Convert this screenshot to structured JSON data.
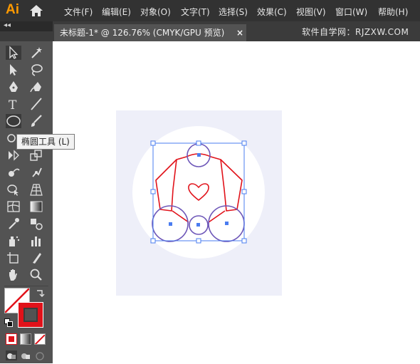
{
  "app": {
    "logo": "Ai"
  },
  "menu": {
    "items": [
      "文件(F)",
      "编辑(E)",
      "对象(O)",
      "文字(T)",
      "选择(S)",
      "效果(C)",
      "视图(V)",
      "窗口(W)",
      "帮助(H)"
    ]
  },
  "tab": {
    "title": "未标题-1* @ 126.76% (CMYK/GPU 预览)",
    "close": "×"
  },
  "watermark": "软件自学网：RJZXW.COM",
  "toolbar": {
    "collapse": "◂◂"
  },
  "tooltip": {
    "text": "椭圆工具 (L)"
  },
  "colors": {
    "menubar": "#323232",
    "toolbar": "#535353",
    "artboard": "#eeeff9",
    "stroke_red": "#e1121a",
    "circle_purple": "#6d56b8",
    "selection": "#4a7cf0"
  },
  "tools": [
    "selection-tool-icon",
    "magic-wand-icon",
    "direct-selection-icon",
    "lasso-icon",
    "pen-tool-icon",
    "curvature-tool-icon",
    "type-tool-icon",
    "line-segment-icon",
    "ellipse-tool-icon",
    "paintbrush-icon",
    "shaper-tool-icon",
    "eraser-tool-icon",
    "rotate-tool-icon",
    "scale-tool-icon",
    "warp-tool-icon",
    "puppet-warp-icon",
    "shape-builder-icon",
    "perspective-grid-icon",
    "mesh-tool-icon",
    "gradient-tool-icon",
    "eyedropper-icon",
    "blend-tool-icon",
    "symbol-sprayer-icon",
    "column-graph-icon",
    "artboard-tool-icon",
    "slice-tool-icon",
    "hand-tool-icon",
    "zoom-tool-icon"
  ]
}
